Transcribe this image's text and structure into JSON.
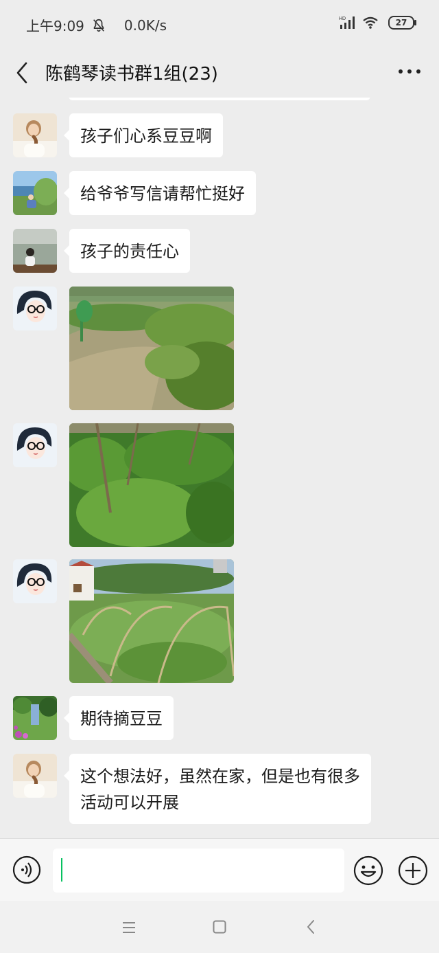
{
  "status_bar": {
    "time": "上午9:09",
    "network_speed": "0.0K/s",
    "signal_label": "HD",
    "battery_level": "27"
  },
  "header": {
    "title": "陈鹤琴读书群1组(23)"
  },
  "messages": [
    {
      "type": "text",
      "avatar": "woman-ponytail-avatar",
      "text": "孩子们心系豆豆啊"
    },
    {
      "type": "text",
      "avatar": "lakeside-sitting-avatar",
      "text": "给爷爷写信请帮忙挺好"
    },
    {
      "type": "text",
      "avatar": "river-child-avatar",
      "text": "孩子的责任心"
    },
    {
      "type": "image",
      "avatar": "glasses-girl-avatar",
      "image": "garden-path-photo"
    },
    {
      "type": "image",
      "avatar": "glasses-girl-avatar",
      "image": "pea-plants-photo"
    },
    {
      "type": "image",
      "avatar": "glasses-girl-avatar",
      "image": "garden-arches-photo"
    },
    {
      "type": "text",
      "avatar": "garden-flowers-avatar",
      "text": "期待摘豆豆"
    },
    {
      "type": "text",
      "avatar": "woman-ponytail-avatar",
      "text": "这个想法好，虽然在家，但是也有很多活动可以开展"
    }
  ],
  "input_bar": {
    "value": ""
  },
  "colors": {
    "background": "#ededed",
    "bubble": "#ffffff",
    "caret": "#07c160"
  }
}
